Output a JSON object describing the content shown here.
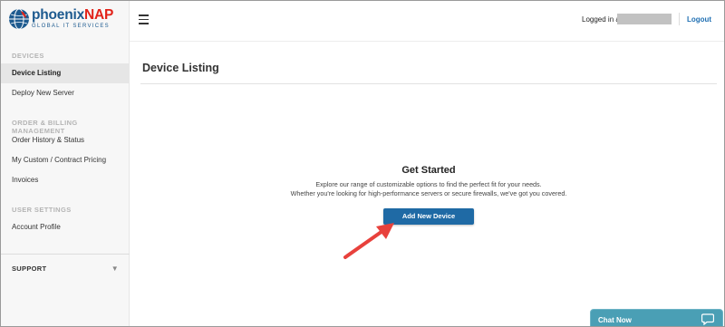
{
  "brand": {
    "name_part1": "phoenix",
    "name_part2": "NAP",
    "tagline": "GLOBAL IT SERVICES",
    "colors": {
      "blue": "#1d5a8f",
      "red": "#e2231a"
    }
  },
  "header": {
    "menu_icon": "hamburger-icon",
    "logged_in_text": "Logged in as",
    "logout_label": "Logout"
  },
  "sidebar": {
    "sections": [
      {
        "title": "DEVICES",
        "items": [
          {
            "label": "Device Listing",
            "active": true
          },
          {
            "label": "Deploy New Server",
            "active": false
          }
        ]
      },
      {
        "title": "ORDER & BILLING MANAGEMENT",
        "items": [
          {
            "label": "Order History & Status"
          },
          {
            "label": "My Custom / Contract Pricing"
          },
          {
            "label": "Invoices"
          }
        ]
      },
      {
        "title": "USER SETTINGS",
        "items": [
          {
            "label": "Account Profile"
          }
        ]
      }
    ],
    "support_label": "SUPPORT",
    "support_icon": "chevron-down-icon"
  },
  "main": {
    "page_title": "Device Listing",
    "heading": "Get Started",
    "description_line1": "Explore our range of customizable options to find the perfect fit for your needs.",
    "description_line2": "Whether you're looking for high-performance servers or secure firewalls, we've got you covered.",
    "add_button_label": "Add New Device",
    "accent_color": "#1f6aa5",
    "annotation_arrow_color": "#e8413c"
  },
  "chat": {
    "label": "Chat Now",
    "icon": "chat-bubble-icon",
    "color": "#4a9fb5"
  }
}
